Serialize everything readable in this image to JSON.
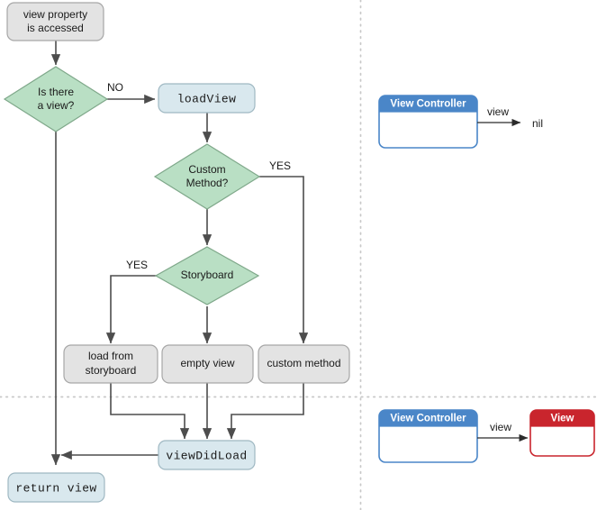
{
  "diagram": {
    "title": "UIViewController view loading flowchart",
    "colors": {
      "process_fill": "#e3e3e3",
      "process_stroke": "#a6a6a6",
      "decision_fill": "#b9dfc4",
      "decision_stroke": "#7fa88a",
      "code_fill": "#d9e8ee",
      "code_stroke": "#9fb8c2",
      "arrow": "#4d4d4d",
      "divider": "#c8c8c8",
      "vc_header": "#4a86c8",
      "vc_border": "#4a86c8",
      "view_header": "#c9252d",
      "view_border": "#c9252d",
      "text": "#1a1a1a"
    },
    "nodes": [
      {
        "id": "start",
        "label": "view property\nis accessed",
        "shape": "rounded-rect",
        "style": "process"
      },
      {
        "id": "is_there_view",
        "label": "Is there\na view?",
        "shape": "diamond",
        "style": "decision"
      },
      {
        "id": "load_view",
        "label": "loadView",
        "shape": "rounded-rect",
        "style": "code"
      },
      {
        "id": "custom_method",
        "label": "Custom\nMethod?",
        "shape": "diamond",
        "style": "decision"
      },
      {
        "id": "storyboard",
        "label": "Storyboard",
        "shape": "diamond",
        "style": "decision"
      },
      {
        "id": "load_from_sb",
        "label": "load from\nstoryboard",
        "shape": "rounded-rect",
        "style": "process"
      },
      {
        "id": "empty_view",
        "label": "empty view",
        "shape": "rounded-rect",
        "style": "process"
      },
      {
        "id": "custom_meth",
        "label": "custom method",
        "shape": "rounded-rect",
        "style": "process"
      },
      {
        "id": "view_did_load",
        "label": "viewDidLoad",
        "shape": "rounded-rect",
        "style": "code"
      },
      {
        "id": "return_view",
        "label": "return view",
        "shape": "rounded-rect",
        "style": "code"
      }
    ],
    "node_text": {
      "start_line1": "view property",
      "start_line2": "is accessed",
      "is_there_view_line1": "Is there",
      "is_there_view_line2": "a view?",
      "load_view": "loadView",
      "custom_method_line1": "Custom",
      "custom_method_line2": "Method?",
      "storyboard": "Storyboard",
      "load_from_storyboard_line1": "load from",
      "load_from_storyboard_line2": "storyboard",
      "empty_view": "empty view",
      "custom_method_box": "custom method",
      "view_did_load": "viewDidLoad",
      "return_view": "return view"
    },
    "edge_labels": {
      "is_there_view_no": "NO",
      "custom_method_yes": "YES",
      "storyboard_yes": "YES"
    },
    "panels": {
      "top": {
        "vc_title": "View Controller",
        "relation": "view",
        "target": "nil"
      },
      "bottom": {
        "vc_title": "View Controller",
        "relation": "view",
        "target_title": "View"
      }
    }
  }
}
